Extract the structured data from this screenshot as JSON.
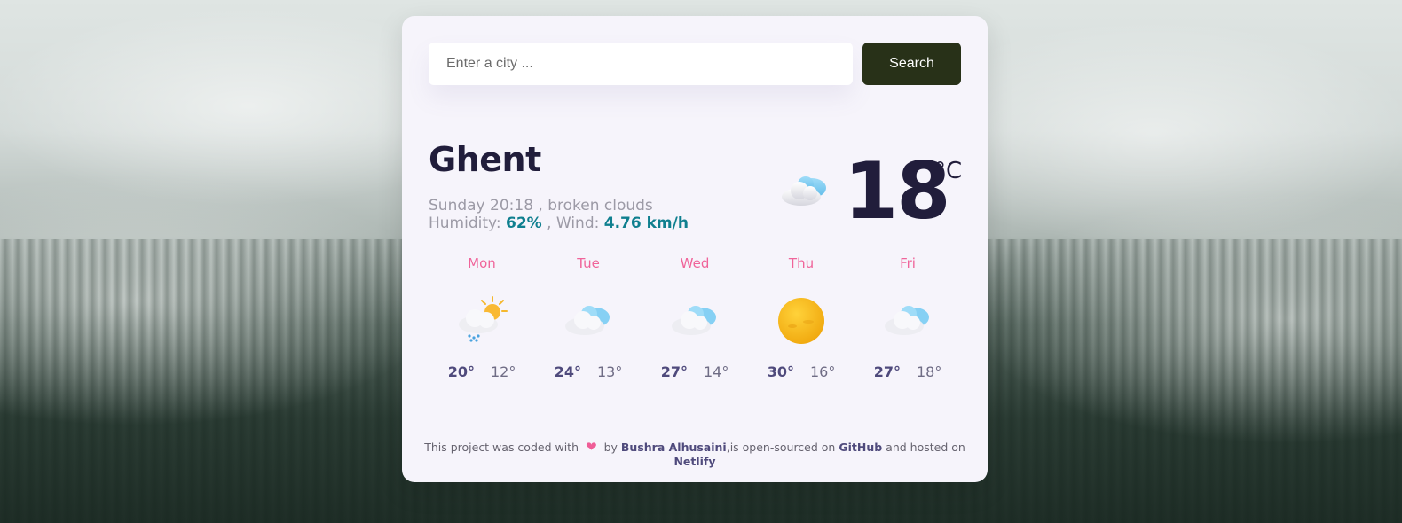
{
  "search": {
    "placeholder": "Enter a city ...",
    "button_label": "Search"
  },
  "current": {
    "city": "Ghent",
    "summary": "Sunday 20:18 , broken clouds",
    "humidity_label": "Humidity: ",
    "humidity_value": "62%",
    "wind_label": " , Wind: ",
    "wind_value": "4.76 km/h",
    "temperature": "18",
    "unit": "°C",
    "icon": "cloud-icon"
  },
  "forecast": [
    {
      "day": "Mon",
      "max": "20°",
      "min": "12°",
      "icon": "rain-sun-icon"
    },
    {
      "day": "Tue",
      "max": "24°",
      "min": "13°",
      "icon": "cloud-icon"
    },
    {
      "day": "Wed",
      "max": "27°",
      "min": "14°",
      "icon": "cloud-icon"
    },
    {
      "day": "Thu",
      "max": "30°",
      "min": "16°",
      "icon": "sun-icon"
    },
    {
      "day": "Fri",
      "max": "27°",
      "min": "18°",
      "icon": "cloud-icon"
    }
  ],
  "footer": {
    "text1": "This project was coded with",
    "heart": "❤",
    "text2": "by",
    "author": "Bushra Alhusaini",
    "text3": ",is open-sourced on",
    "github": "GitHub",
    "text4": "and hosted on",
    "netlify": "Netlify"
  },
  "colors": {
    "accent": "#0f7f8f",
    "button": "#283118",
    "day": "#f0649a",
    "text": "#211d3b"
  }
}
